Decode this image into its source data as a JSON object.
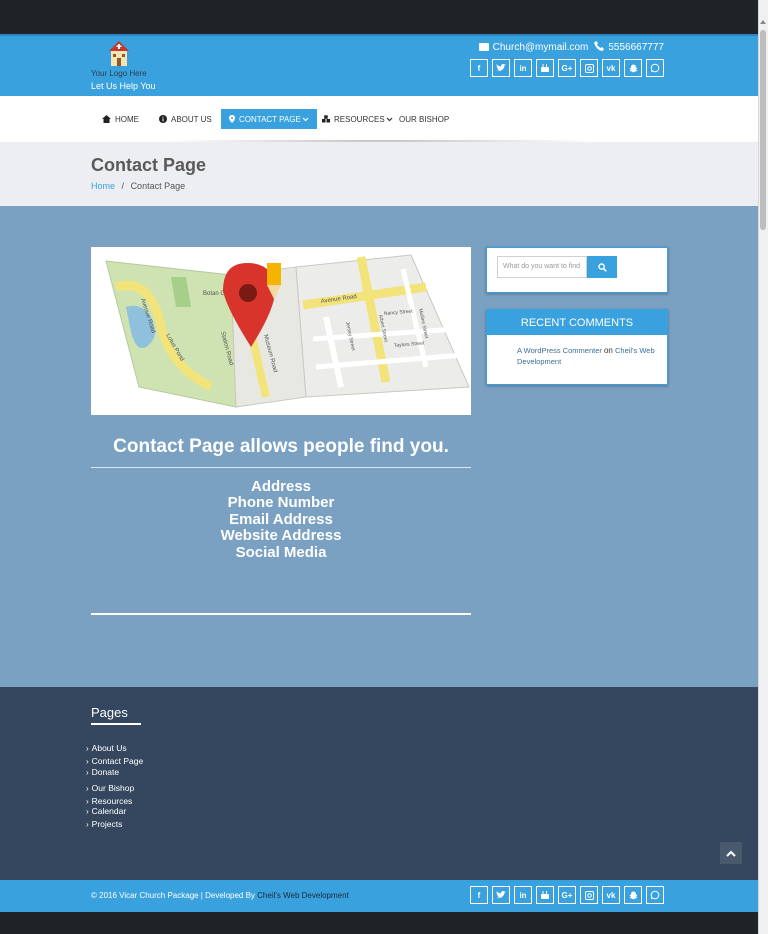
{
  "header": {
    "logo_text": "Your Logo Here",
    "tagline": "Let Us Help You",
    "email": "Church@mymail.com",
    "phone": "5556667777",
    "social": [
      "f",
      "t",
      "in",
      "yt",
      "G+",
      "ig",
      "vk",
      "sc",
      "wa"
    ]
  },
  "nav": {
    "items": [
      {
        "label": "HOME",
        "icon": "home-icon"
      },
      {
        "label": "ABOUT US",
        "icon": "info-icon"
      },
      {
        "label": "CONTACT PAGE",
        "icon": "map-marker-icon"
      },
      {
        "label": "RESOURCES",
        "icon": "cubes-icon"
      },
      {
        "label": "OUR BISHOP",
        "icon": ""
      }
    ]
  },
  "page": {
    "title": "Contact Page",
    "breadcrumb_home": "Home",
    "breadcrumb_sep": "/",
    "breadcrumb_current": "Contact Page"
  },
  "main": {
    "heading": "Contact Page allows people find you.",
    "info_lines": [
      "Address",
      "Phone Number",
      "Email Address",
      "Website Address",
      "Social Media"
    ],
    "map_labels": {
      "avenue_road_1": "Avenue Road",
      "avenue_road_2": "Avenue Road",
      "lotus_pond": "Lotus Pond",
      "botanical": "Botan Gard",
      "nancy_street": "Nancy Street",
      "albert_street": "Albert Street",
      "station_road": "Station Road",
      "taylors_street": "Taylors Street",
      "museum_road": "Museum Road",
      "jersey_street": "Jersey Street",
      "mullins_street": "Mullins Street"
    }
  },
  "sidebar": {
    "search_placeholder": "What do you want to find",
    "recent_title": "RECENT COMMENTS",
    "comment_author": "A WordPress Commenter",
    "comment_on": "on",
    "comment_post": "Cheil's Web Development"
  },
  "footer": {
    "pages_title": "Pages",
    "links": [
      "About Us",
      "Contact Page",
      "Donate",
      "Our Bishop",
      "Resources",
      "Calendar",
      "Projects"
    ],
    "copyright": "© 2016 Vicar Church Package | Developed By ",
    "developer": "Cheil's Web Development"
  },
  "colors": {
    "accent": "#3aa1df",
    "main_bg": "#7aa0c2",
    "footer_bg": "#34475f"
  }
}
